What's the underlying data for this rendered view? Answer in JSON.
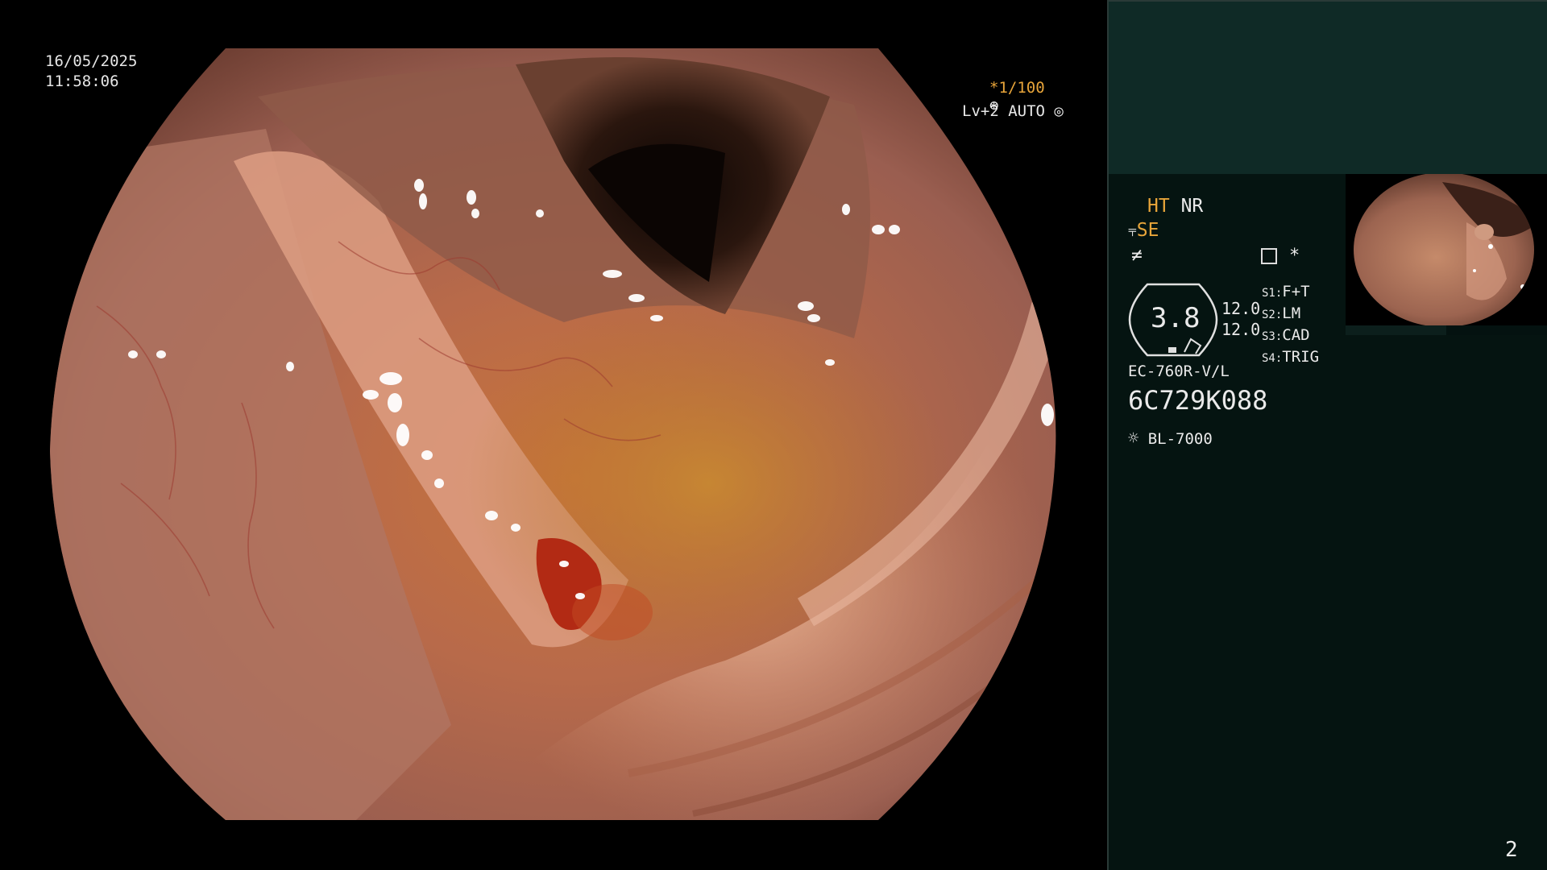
{
  "osd": {
    "date": "16/05/2025",
    "time": "11:58:06",
    "shutter": "*1/100",
    "level": "Lv+2 AUTO"
  },
  "panel": {
    "ht_label": "HT",
    "nr_label": "NR",
    "se_label": "SE",
    "zoom_value": "3.8",
    "left_values": [
      "12.0",
      "12.0"
    ],
    "switches": [
      {
        "key": "S1:",
        "value": "F+T"
      },
      {
        "key": "S2:",
        "value": "LM"
      },
      {
        "key": "S3:",
        "value": "CAD"
      },
      {
        "key": "S4:",
        "value": "TRIG"
      }
    ],
    "scope_model": "EC-760R-V/L",
    "serial": "6C729K088",
    "light_source": "BL-7000",
    "asterisk": "*"
  },
  "page_number": "2",
  "colors": {
    "accent_orange": "#e8a53a",
    "panel_bg": "#051411",
    "panel_top_bg": "#0f2a26"
  }
}
